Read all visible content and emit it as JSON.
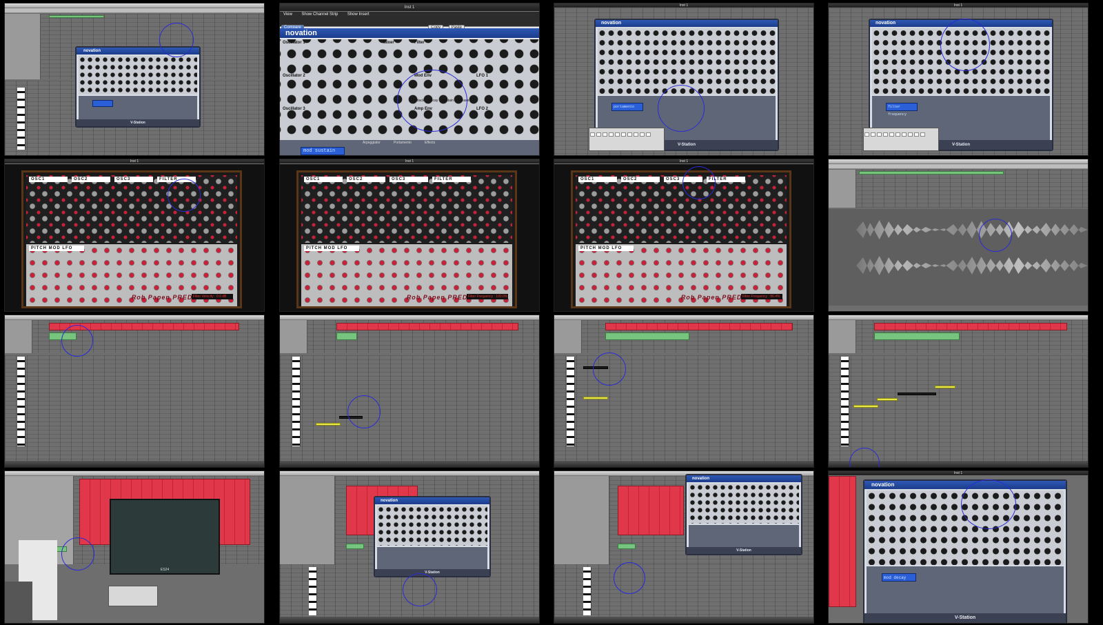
{
  "plugin": {
    "brand": "novation",
    "model": "V-Station",
    "lcd_tiles": {
      "detail_top": "mod sustain",
      "t3": "portamento",
      "t4": "filter frequency",
      "t16": "mod decay"
    },
    "tile2_labels": {
      "oscillator1": "Oscillator 1",
      "oscillator2": "Oscillator 2",
      "oscillator3": "Oscillator 3",
      "mixer": "Mixer",
      "filter": "Filter",
      "mod_env": "Mod Env",
      "amp_env": "Amp Env",
      "lfo1": "LFO 1",
      "lfo2": "LFO 2",
      "arpeggiator": "Arpeggiator",
      "portamento": "Portamento",
      "effects": "Effects",
      "mod_env_knobs": [
        "attack",
        "decay",
        "sustain",
        "release"
      ]
    }
  },
  "window": {
    "inst_title": "Inst 1",
    "menu_view": "View",
    "menu_show_channel_strip": "Show Channel Strip",
    "menu_show_insert": "Show Insert",
    "compare_button": "Compare",
    "copy_button": "Copy",
    "paste_button": "Paste"
  },
  "predator": {
    "logo": "Rob Papen PREDATOR",
    "osc1": "OSC1",
    "osc2": "OSC2",
    "osc3": "OSC3",
    "filter": "FILTER",
    "pitch_mod": "PITCH MOD LFO",
    "status_t5": "Filter Velocity : 0.0 dB",
    "status_t6": "Filter Frequency : 100.0%",
    "status_t7": "Filter Frequency : 86.4%"
  },
  "mixer_plugin": {
    "name": "ES24"
  },
  "colors": {
    "region_red": "#e0374a",
    "region_green": "#77c47f",
    "note_yellow": "#e9e84a",
    "cursor_circle": "#2a2ad8",
    "novation_blue": "#2e58b5"
  }
}
